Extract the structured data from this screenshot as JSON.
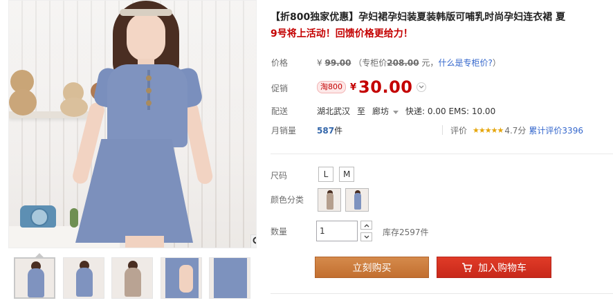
{
  "product": {
    "title": "【折800独家优惠】孕妇裙孕妇装夏装韩版可哺乳时尚孕妇连衣裙 夏",
    "subtitle": "9号将上活动！回馈价格更给力！"
  },
  "price": {
    "label": "价格",
    "currency": "¥",
    "original": "99.00",
    "counter_prefix": "（专柜价",
    "counter_price": "208.00",
    "counter_suffix": "元，",
    "counter_link": "什么是专柜价?",
    "counter_close": "）"
  },
  "promo": {
    "label": "促销",
    "badge": "淘800",
    "currency": "¥",
    "price": "30.00"
  },
  "shipping": {
    "label": "配送",
    "from": "湖北武汉",
    "to_word": "至",
    "to": "廊坊",
    "fee": "快递: 0.00 EMS: 10.00"
  },
  "sales": {
    "label": "月销量",
    "count": "587",
    "unit": "件",
    "review_label": "评价",
    "rating": 4.7,
    "stars": "★★★★★",
    "score": "4.7分",
    "total_reviews": "累计评价3396"
  },
  "options": {
    "size_label": "尺码",
    "sizes": [
      "L",
      "M"
    ],
    "color_label": "颜色分类",
    "colors": [
      "beige-dress-thumb",
      "blue-dress-thumb"
    ]
  },
  "quantity": {
    "label": "数量",
    "value": "1",
    "stock": "库存2597件"
  },
  "actions": {
    "buy": "立刻购买",
    "cart": "加入购物车"
  },
  "icons": {
    "zoom": "magnifier-icon",
    "cart": "cart-icon",
    "dropdown": "chevron-down-icon"
  },
  "colors": {
    "accent_red": "#c40000",
    "buy_orange": "#c8783a",
    "cart_red": "#d8321f",
    "link_blue": "#3366cc",
    "star_gold": "#e5a50a"
  }
}
